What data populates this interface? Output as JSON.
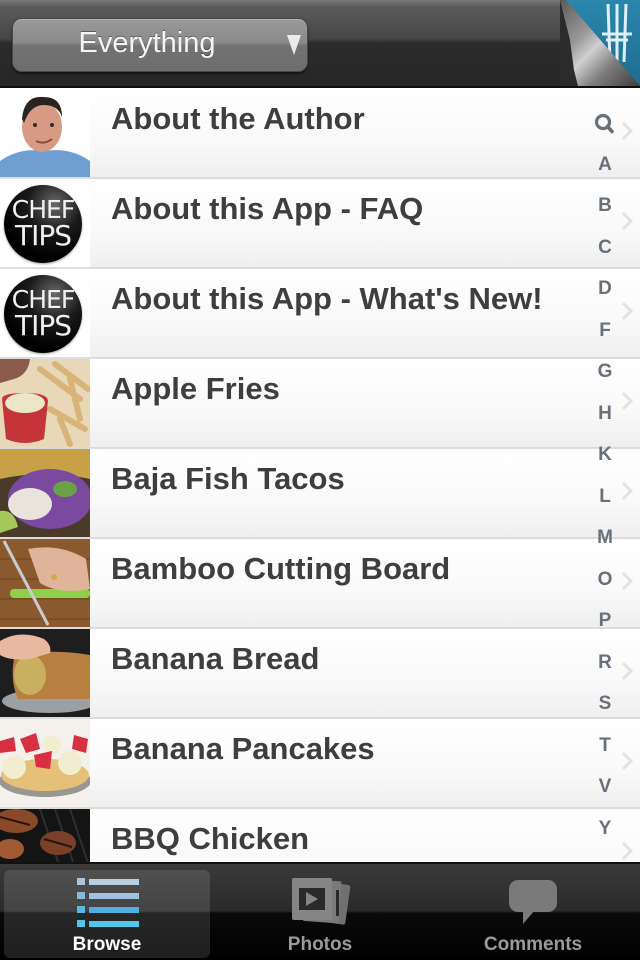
{
  "header": {
    "filter_select": {
      "value": "Everything",
      "caret_icon": "triangle-down-icon"
    },
    "page_curl_icon": "page-curl-icon"
  },
  "list": {
    "items": [
      {
        "title": "About the Author",
        "thumb": "author-photo"
      },
      {
        "title": "About this App - FAQ",
        "thumb": "chef-tips-logo"
      },
      {
        "title": "About this App - What's New!",
        "thumb": "chef-tips-logo"
      },
      {
        "title": "Apple Fries",
        "thumb": "apple-fries-photo"
      },
      {
        "title": "Baja Fish Tacos",
        "thumb": "fish-tacos-photo"
      },
      {
        "title": "Bamboo Cutting Board",
        "thumb": "cutting-board-photo"
      },
      {
        "title": "Banana Bread",
        "thumb": "banana-bread-photo"
      },
      {
        "title": "Banana Pancakes",
        "thumb": "banana-pancakes-photo"
      },
      {
        "title": "BBQ Chicken",
        "thumb": "bbq-chicken-photo"
      }
    ],
    "logo_text": {
      "line1": "CHEF",
      "line2": "TIPS"
    }
  },
  "index_bar": {
    "entries": [
      "search",
      "A",
      "B",
      "C",
      "D",
      "F",
      "G",
      "H",
      "K",
      "L",
      "M",
      "O",
      "P",
      "R",
      "S",
      "T",
      "V",
      "Y"
    ]
  },
  "tabbar": {
    "tabs": [
      {
        "label": "Browse",
        "icon": "list-icon",
        "active": true
      },
      {
        "label": "Photos",
        "icon": "photos-icon",
        "active": false
      },
      {
        "label": "Comments",
        "icon": "speech-bubble-icon",
        "active": false
      }
    ]
  },
  "colors": {
    "index_letter": "#68707a",
    "row_title": "#3e3e3e",
    "tab_active_label": "#ffffff",
    "tab_inactive_label": "#9a9a9a",
    "browse_icon_blue": "#4fc6ea"
  }
}
